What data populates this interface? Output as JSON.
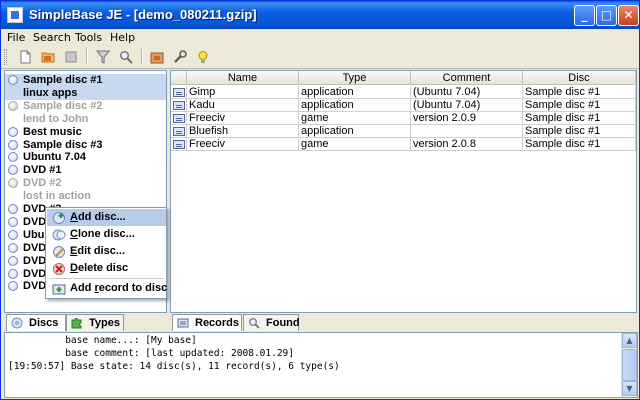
{
  "window": {
    "title": "SimpleBase JE - [demo_080211.gzip]",
    "minimize_label": "_",
    "maximize_label": "□",
    "close_label": "✕"
  },
  "menu": [
    "File",
    "Search",
    "Tools",
    "Help"
  ],
  "toolbar": {
    "buttons": [
      "new-file-icon",
      "open-folder-icon",
      "save-icon",
      "filter-icon",
      "search-icon",
      "box-icon",
      "wrench-icon",
      "lightbulb-icon"
    ]
  },
  "tree": {
    "items": [
      {
        "label": "Sample disc #1",
        "style": "bold",
        "selected": true
      },
      {
        "label": "linux apps",
        "style": "sub"
      },
      {
        "label": "Sample disc #2",
        "style": "grey"
      },
      {
        "label": "lend to John",
        "style": "grey-sub"
      },
      {
        "label": "Best music",
        "style": "bold"
      },
      {
        "label": "Sample disc #3",
        "style": "bold"
      },
      {
        "label": "Ubuntu 7.04",
        "style": "bold"
      },
      {
        "label": "DVD #1",
        "style": "bold"
      },
      {
        "label": "DVD #2",
        "style": "grey"
      },
      {
        "label": "lost in action",
        "style": "grey-sub"
      },
      {
        "label": "DVD #3",
        "style": "bold"
      },
      {
        "label": "DVD #4",
        "style": "bold"
      },
      {
        "label": "Ubuntu 7.10",
        "style": "bold"
      },
      {
        "label": "DVD #5",
        "style": "bold"
      },
      {
        "label": "DVD #6",
        "style": "bold"
      },
      {
        "label": "DVD #7",
        "style": "bold"
      },
      {
        "label": "DVD #8",
        "style": "bold"
      }
    ]
  },
  "left_tabs": [
    {
      "label": "Discs",
      "active": true,
      "icon": "disc-icon"
    },
    {
      "label": "Types",
      "active": false,
      "icon": "puzzle-icon"
    }
  ],
  "table": {
    "columns": [
      "Name",
      "Type",
      "Comment",
      "Disc"
    ],
    "rows": [
      [
        "Gimp",
        "application",
        "(Ubuntu 7.04)",
        "Sample disc #1"
      ],
      [
        "Kadu",
        "application",
        "(Ubuntu 7.04)",
        "Sample disc #1"
      ],
      [
        "Freeciv",
        "game",
        "version 2.0.9",
        "Sample disc #1"
      ],
      [
        "Bluefish",
        "application",
        "",
        "Sample disc #1"
      ],
      [
        "Freeciv",
        "game",
        "version 2.0.8",
        "Sample disc #1"
      ]
    ]
  },
  "right_tabs": [
    {
      "label": "Records",
      "active": true,
      "icon": "records-icon"
    },
    {
      "label": "Found",
      "active": false,
      "icon": "magnifier-icon"
    }
  ],
  "context_menu": {
    "items": [
      {
        "mnemonic": "A",
        "rest": "dd disc...",
        "icon": "add-disc-icon",
        "highlighted": true
      },
      {
        "mnemonic": "C",
        "rest": "lone disc...",
        "icon": "clone-disc-icon",
        "highlighted": false
      },
      {
        "mnemonic": "E",
        "rest": "dit disc...",
        "icon": "edit-disc-icon",
        "highlighted": false
      },
      {
        "mnemonic": "D",
        "rest": "elete disc",
        "icon": "delete-disc-icon",
        "highlighted": false
      },
      {
        "mnemonic": "",
        "prefix": "Add ",
        "under": "r",
        "rest": "ecord to disc",
        "icon": "add-record-icon",
        "highlighted": false
      }
    ]
  },
  "console": {
    "lines": [
      "          base name...: [My base]",
      "          base comment: [last updated: 2008.01.29]",
      "[19:50:57] Base state: 14 disc(s), 11 record(s), 6 type(s)"
    ]
  }
}
